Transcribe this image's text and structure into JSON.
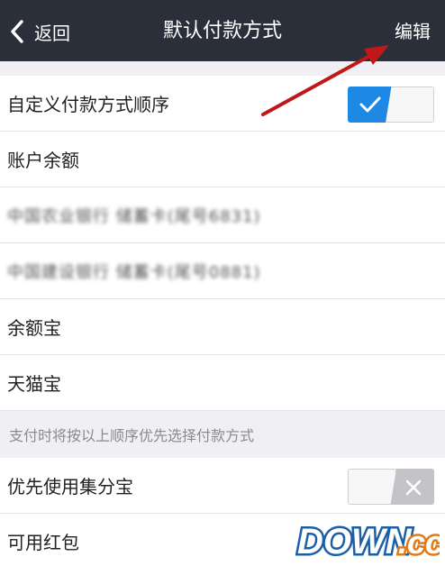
{
  "navbar": {
    "back_label": "返回",
    "title": "默认付款方式",
    "edit_label": "编辑"
  },
  "rows": {
    "custom_order": {
      "label": "自定义付款方式顺序",
      "toggle_on": true
    },
    "balance": {
      "label": "账户余额"
    },
    "bank_abc": {
      "label": "中国农业银行 储蓄卡(尾号6831)"
    },
    "bank_ccb": {
      "label": "中国建设银行 储蓄卡(尾号0881)"
    },
    "yuebao": {
      "label": "余额宝"
    },
    "tmallbao": {
      "label": "天猫宝"
    }
  },
  "hint": "支付时将按以上顺序优先选择付款方式",
  "bottom": {
    "jifenbao": {
      "label": "优先使用集分宝",
      "toggle_on": false
    },
    "hongbao": {
      "label": "可用红包"
    }
  },
  "watermark": {
    "text": "DOWN",
    "suffix": ".cc"
  },
  "colors": {
    "navbar": "#2a2f3a",
    "toggle_on": "#1e88e5",
    "arrow": "#c01818"
  },
  "icons": {
    "back": "chevron-left-icon",
    "check": "check-icon",
    "close": "close-icon"
  }
}
